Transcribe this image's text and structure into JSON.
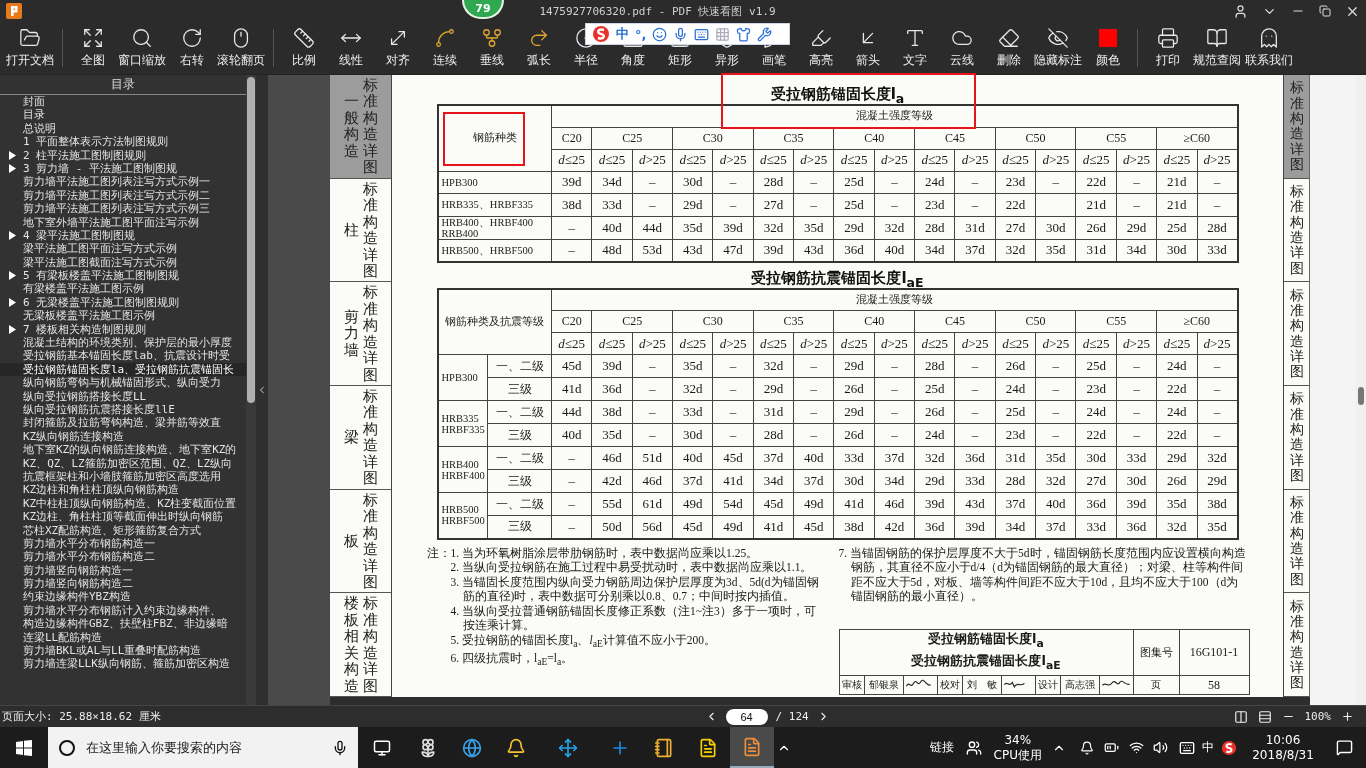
{
  "window": {
    "title": "1475927706320.pdf - PDF 快速看图 v1.9",
    "badge": "79"
  },
  "toolbar": {
    "groups": [
      [
        {
          "label": "打开文档"
        }
      ],
      [
        {
          "label": "全图"
        },
        {
          "label": "窗口缩放"
        },
        {
          "label": "右转"
        },
        {
          "label": "滚轮翻页"
        }
      ],
      [
        {
          "label": "比例"
        },
        {
          "label": "线性"
        },
        {
          "label": "对齐"
        },
        {
          "label": "连续"
        },
        {
          "label": "垂线"
        },
        {
          "label": "弧长"
        },
        {
          "label": "半径"
        },
        {
          "label": "角度"
        },
        {
          "label": "矩形"
        },
        {
          "label": "异形"
        },
        {
          "label": "画笔"
        },
        {
          "label": "高亮"
        },
        {
          "label": "箭头"
        },
        {
          "label": "文字"
        },
        {
          "label": "云线"
        },
        {
          "label": "删除"
        },
        {
          "label": "隐藏标注"
        },
        {
          "label": "颜色",
          "color": "#ff0000"
        }
      ],
      [
        {
          "label": "打印"
        },
        {
          "label": "规范查阅"
        },
        {
          "label": "联系我们"
        }
      ]
    ]
  },
  "ime_bar": {
    "mode": "中",
    "punctuation": "°,"
  },
  "sidebar": {
    "title": "目录",
    "items": [
      {
        "label": "封面",
        "kind": "page",
        "selected": false
      },
      {
        "label": "目录",
        "kind": "page",
        "selected": false
      },
      {
        "label": "总说明",
        "kind": "page",
        "selected": false
      },
      {
        "label": "1 平面整体表示方法制图规则",
        "kind": "page",
        "selected": false
      },
      {
        "label": "2 柱平法施工图制图规则",
        "kind": "section",
        "expanded": false,
        "selected": false
      },
      {
        "label": "3 剪力墙 - 平法施工图制图规",
        "kind": "section",
        "expanded": false,
        "selected": false
      },
      {
        "label": "剪力墙平法施工图列表注写方式示例一",
        "kind": "page",
        "selected": false
      },
      {
        "label": "剪力墙平法施工图列表注写方式示例二",
        "kind": "page",
        "selected": false
      },
      {
        "label": "剪力墙平法施工图列表注写方式示例三",
        "kind": "page",
        "selected": false
      },
      {
        "label": "地下室外墙平法施工图平面注写示例",
        "kind": "page",
        "selected": false
      },
      {
        "label": "4 梁平法施工图制图规",
        "kind": "section",
        "expanded": false,
        "selected": false
      },
      {
        "label": "梁平法施工图平面注写方式示例",
        "kind": "page",
        "selected": false
      },
      {
        "label": "梁平法施工图截面注写方式示例",
        "kind": "page",
        "selected": false
      },
      {
        "label": "5 有梁板楼盖平法施工图制图规",
        "kind": "section",
        "expanded": false,
        "selected": false
      },
      {
        "label": "有梁楼盖平法施工图示例",
        "kind": "page",
        "selected": false
      },
      {
        "label": "6 无梁楼盖平法施工图制图规则",
        "kind": "section",
        "expanded": false,
        "selected": false
      },
      {
        "label": "无梁板楼盖平法施工图示例",
        "kind": "page",
        "selected": false
      },
      {
        "label": "7 楼板相关构造制图规则",
        "kind": "section",
        "expanded": false,
        "selected": false
      },
      {
        "label": "混凝土结构的环境类别、保护层的最小厚度",
        "kind": "page",
        "selected": false
      },
      {
        "label": "受拉钢筋基本锚固长度lab、抗震设计时受",
        "kind": "page",
        "selected": false
      },
      {
        "label": "受拉钢筋锚固长度la、受拉钢筋抗震锚固长",
        "kind": "page",
        "selected": true
      },
      {
        "label": "纵向钢筋弯钩与机械锚固形式、纵向受力",
        "kind": "page",
        "selected": false
      },
      {
        "label": "纵向受拉钢筋搭接长度LL",
        "kind": "page",
        "selected": false
      },
      {
        "label": "纵向受拉钢筋抗震搭接长度llE",
        "kind": "page",
        "selected": false
      },
      {
        "label": "封闭箍筋及拉筋弯钩构造、梁并筋等效直",
        "kind": "page",
        "selected": false
      },
      {
        "label": "KZ纵向钢筋连接构造",
        "kind": "page",
        "selected": false
      },
      {
        "label": "地下室KZ的纵向钢筋连接构造、地下室KZ的",
        "kind": "page",
        "selected": false
      },
      {
        "label": "KZ、QZ、LZ箍筋加密区范围、QZ、LZ纵向",
        "kind": "page",
        "selected": false
      },
      {
        "label": "抗震框架柱和小墙肢箍筋加密区高度选用",
        "kind": "page",
        "selected": false
      },
      {
        "label": "KZ边柱和角柱柱顶纵向钢筋构造",
        "kind": "page",
        "selected": false
      },
      {
        "label": "KZ中柱柱顶纵向钢筋构造、KZ柱变截面位置",
        "kind": "page",
        "selected": false
      },
      {
        "label": "KZ边柱、角柱柱顶等截面伸出时纵向钢筋",
        "kind": "page",
        "selected": false
      },
      {
        "label": "芯柱XZ配筋构造、矩形箍筋复合方式",
        "kind": "page",
        "selected": false
      },
      {
        "label": "剪力墙水平分布钢筋构造一",
        "kind": "page",
        "selected": false
      },
      {
        "label": "剪力墙水平分布钢筋构造二",
        "kind": "page",
        "selected": false
      },
      {
        "label": "剪力墙竖向钢筋构造一",
        "kind": "page",
        "selected": false
      },
      {
        "label": "剪力墙竖向钢筋构造二",
        "kind": "page",
        "selected": false
      },
      {
        "label": "约束边缘构件YBZ构造",
        "kind": "page",
        "selected": false
      },
      {
        "label": "剪力墙水平分布钢筋计入约束边缘构件、",
        "kind": "page",
        "selected": false
      },
      {
        "label": "构造边缘构件GBZ、扶壁柱FBZ、非边缘暗",
        "kind": "page",
        "selected": false
      },
      {
        "label": "连梁LL配筋构造",
        "kind": "page",
        "selected": false
      },
      {
        "label": "剪力墙BKL或AL与LL重叠时配筋构造",
        "kind": "page",
        "selected": false
      },
      {
        "label": "剪力墙连梁LLK纵向钢筋、箍筋加密区构造",
        "kind": "page",
        "selected": false
      }
    ]
  },
  "document": {
    "left_tabs": [
      {
        "section": "一般构造",
        "label": "标准构造详图",
        "selected": true
      },
      {
        "section": "柱",
        "label": "标准构造详图",
        "selected": false
      },
      {
        "section": "剪力墙",
        "label": "标准构造详图",
        "selected": false
      },
      {
        "section": "梁",
        "label": "标准构造详图",
        "selected": false
      },
      {
        "section": "板",
        "label": "标准构造详图",
        "selected": false
      },
      {
        "section": "楼板相关构造",
        "label": "标准构造详图",
        "selected": false
      }
    ],
    "right_tabs": [
      {
        "label": "标准构造详图",
        "selected": true
      },
      {
        "label": "标准构造详图",
        "selected": false
      },
      {
        "label": "标准构造详图",
        "selected": false
      },
      {
        "label": "标准构造详图",
        "selected": false
      },
      {
        "label": "标准构造详图",
        "selected": false
      },
      {
        "label": "标准构造详图",
        "selected": false
      }
    ],
    "table_1": {
      "title": "受拉钢筋锚固长度l$_{a}$",
      "title_highlighted": true,
      "corner": "钢筋种类",
      "corner_highlighted": true,
      "group_header": "混凝土强度等级",
      "grades": [
        {
          "label": "C20",
          "subs": [
            "*d*≤25"
          ]
        },
        {
          "label": "C25",
          "subs": [
            "*d*≤25",
            "*d*>25"
          ]
        },
        {
          "label": "C30",
          "subs": [
            "*d*≤25",
            "*d*>25"
          ]
        },
        {
          "label": "C35",
          "subs": [
            "*d*≤25",
            "*d*>25"
          ]
        },
        {
          "label": "C40",
          "subs": [
            "*d*≤25",
            "*d*>25"
          ]
        },
        {
          "label": "C45",
          "subs": [
            "*d*≤25",
            "*d*>25"
          ]
        },
        {
          "label": "C50",
          "subs": [
            "*d*≤25",
            "*d*>25"
          ]
        },
        {
          "label": "C55",
          "subs": [
            "*d*≤25",
            "*d*>25"
          ]
        },
        {
          "label": "≥C60",
          "subs": [
            "*d*≤25",
            "*d*>25"
          ]
        }
      ],
      "rows": [
        {
          "name": "HPB300",
          "cells": [
            "39d",
            "34d",
            "–",
            "30d",
            "–",
            "28d",
            "–",
            "25d",
            "–",
            "24d",
            "–",
            "23d",
            "–",
            "22d",
            "–",
            "21d",
            "–"
          ]
        },
        {
          "name": "HRB335、HRBF335",
          "cells": [
            "38d",
            "33d",
            "–",
            "29d",
            "–",
            "27d",
            "–",
            "25d",
            "–",
            "23d",
            "–",
            "22d",
            null,
            "21d",
            "–",
            "21d",
            "–"
          ]
        },
        {
          "name": "HRB400、HRBF400\nRRB400",
          "cells": [
            "–",
            "40d",
            "44d",
            "35d",
            "39d",
            "32d",
            "35d",
            "29d",
            "32d",
            "28d",
            "31d",
            "27d",
            "30d",
            "26d",
            "29d",
            "25d",
            "28d"
          ]
        },
        {
          "name": "HRB500、HRBF500",
          "cells": [
            "–",
            "48d",
            "53d",
            "43d",
            "47d",
            "39d",
            "43d",
            "36d",
            "40d",
            "34d",
            "37d",
            "32d",
            "35d",
            "31d",
            "34d",
            "30d",
            "33d"
          ]
        }
      ]
    },
    "table_2": {
      "title": "受拉钢筋抗震锚固长度l$_{aE}$",
      "corner": "钢筋种类及抗震等级",
      "group_header": "混凝土强度等级",
      "grades": [
        {
          "label": "C20",
          "subs": [
            "*d*≤25"
          ]
        },
        {
          "label": "C25",
          "subs": [
            "*d*≤25",
            "*d*>25"
          ]
        },
        {
          "label": "C30",
          "subs": [
            "*d*≤25",
            "*d*>25"
          ]
        },
        {
          "label": "C35",
          "subs": [
            "*d*≤25",
            "*d*>25"
          ]
        },
        {
          "label": "C40",
          "subs": [
            "*d*≤25",
            "*d*>25"
          ]
        },
        {
          "label": "C45",
          "subs": [
            "*d*≤25",
            "*d*>25"
          ]
        },
        {
          "label": "C50",
          "subs": [
            "*d*≤25",
            "*d*>25"
          ]
        },
        {
          "label": "C55",
          "subs": [
            "*d*≤25",
            "*d*>25"
          ]
        },
        {
          "label": "≥C60",
          "subs": [
            "*d*≤25",
            "*d*>25"
          ]
        }
      ],
      "groups": [
        {
          "name": "HPB300",
          "rows": [
            {
              "class": "一、二级",
              "cells": [
                "45d",
                "39d",
                "–",
                "35d",
                "–",
                "32d",
                "–",
                "29d",
                "–",
                "28d",
                "–",
                "26d",
                "–",
                "25d",
                "–",
                "24d",
                "–"
              ]
            },
            {
              "class": "三级",
              "cells": [
                "41d",
                "36d",
                "–",
                "32d",
                "–",
                "29d",
                "–",
                "26d",
                "–",
                "25d",
                "–",
                "24d",
                "–",
                "23d",
                "–",
                "22d",
                "–"
              ]
            }
          ]
        },
        {
          "name": "HRB335\nHRBF335",
          "rows": [
            {
              "class": "一、二级",
              "cells": [
                "44d",
                "38d",
                "–",
                "33d",
                "–",
                "31d",
                "–",
                "29d",
                "–",
                "26d",
                "–",
                "25d",
                "–",
                "24d",
                "–",
                "24d",
                "–"
              ]
            },
            {
              "class": "三级",
              "cells": [
                "40d",
                "35d",
                "–",
                "30d",
                "–",
                "28d",
                "–",
                "26d",
                "–",
                "24d",
                "–",
                "23d",
                "–",
                "22d",
                "–",
                "22d",
                "–"
              ]
            }
          ]
        },
        {
          "name": "HRB400\nHRBF400",
          "rows": [
            {
              "class": "一、二级",
              "cells": [
                "–",
                "46d",
                "51d",
                "40d",
                "45d",
                "37d",
                "40d",
                "33d",
                "37d",
                "32d",
                "36d",
                "31d",
                "35d",
                "30d",
                "33d",
                "29d",
                "32d"
              ]
            },
            {
              "class": "三级",
              "cells": [
                "–",
                "42d",
                "46d",
                "37d",
                "41d",
                "34d",
                "37d",
                "30d",
                "34d",
                "29d",
                "33d",
                "28d",
                "32d",
                "27d",
                "30d",
                "26d",
                "29d"
              ]
            }
          ]
        },
        {
          "name": "HRB500\nHRBF500",
          "rows": [
            {
              "class": "一、二级",
              "cells": [
                "–",
                "55d",
                "61d",
                "49d",
                "54d",
                "45d",
                "49d",
                "41d",
                "46d",
                "39d",
                "43d",
                "37d",
                "40d",
                "36d",
                "39d",
                "35d",
                "38d"
              ]
            },
            {
              "class": "三级",
              "cells": [
                "–",
                "50d",
                "56d",
                "45d",
                "49d",
                "41d",
                "45d",
                "38d",
                "42d",
                "36d",
                "39d",
                "34d",
                "37d",
                "33d",
                "36d",
                "32d",
                "35d"
              ]
            }
          ]
        }
      ]
    },
    "notes": {
      "prefix": "注：",
      "left": [
        "1. 当为环氧树脂涂层带肋钢筋时，表中数据尚应乘以1.25。",
        "2. 当纵向受拉钢筋在施工过程中易受扰动时，表中数据尚应乘以1.1。",
        "3. 当锚固长度范围内纵向受力钢筋周边保护层厚度为3d、5d(d为锚固钢筋的直径)时，表中数据可分别乘以0.8、0.7；中间时按内插值。",
        "4. 当纵向受拉普通钢筋锚固长度修正系数（注1~注3）多于一项时，可按连乘计算。",
        "5. 受拉钢筋的锚固长度l$_{a}$、*l*$_{aE}$计算值不应小于200。",
        "6. 四级抗震时，l$_{aE}$=l$_{a}$。"
      ],
      "right": [
        "7. 当锚固钢筋的保护层厚度不大于5d时，锚固钢筋长度范围内应设置横向构造钢筋，其直径不应小于d/4（d为锚固钢筋的最大直径）；对梁、柱等构件间距不应大于5d，对板、墙等构件间距不应大于10d，且均不应大于100（d为锚固钢筋的最小直径）。"
      ]
    },
    "title_block": {
      "title_lines": [
        "受拉钢筋锚固长度l$_{a}$",
        "受拉钢筋抗震锚固长度l$_{aE}$"
      ],
      "atlas_label": "图集号",
      "atlas_no": "16G101-1",
      "roles": [
        {
          "role": "审核",
          "name": "郁银泉"
        },
        {
          "role": "校对",
          "name": "刘　敏"
        },
        {
          "role": "设计",
          "name": "高志强"
        }
      ],
      "page_label": "页",
      "page": "58"
    }
  },
  "status_bar": {
    "page_size": "页面大小: 25.88×18.62 厘米",
    "page": "64",
    "total": "/ 124",
    "zoom": "100%"
  },
  "taskbar": {
    "search_placeholder": "在这里输入你要搜索的内容",
    "apps": [
      {
        "active": false
      },
      {
        "active": false
      },
      {
        "active": false
      },
      {
        "active": false
      },
      {
        "active": false
      },
      {
        "active": false
      },
      {
        "active": false
      },
      {
        "active": true
      }
    ],
    "links": "链接",
    "cpu_value": "34%",
    "cpu_label": "CPU使用",
    "ime": "中",
    "time": "10:06",
    "date": "2018/8/31"
  }
}
